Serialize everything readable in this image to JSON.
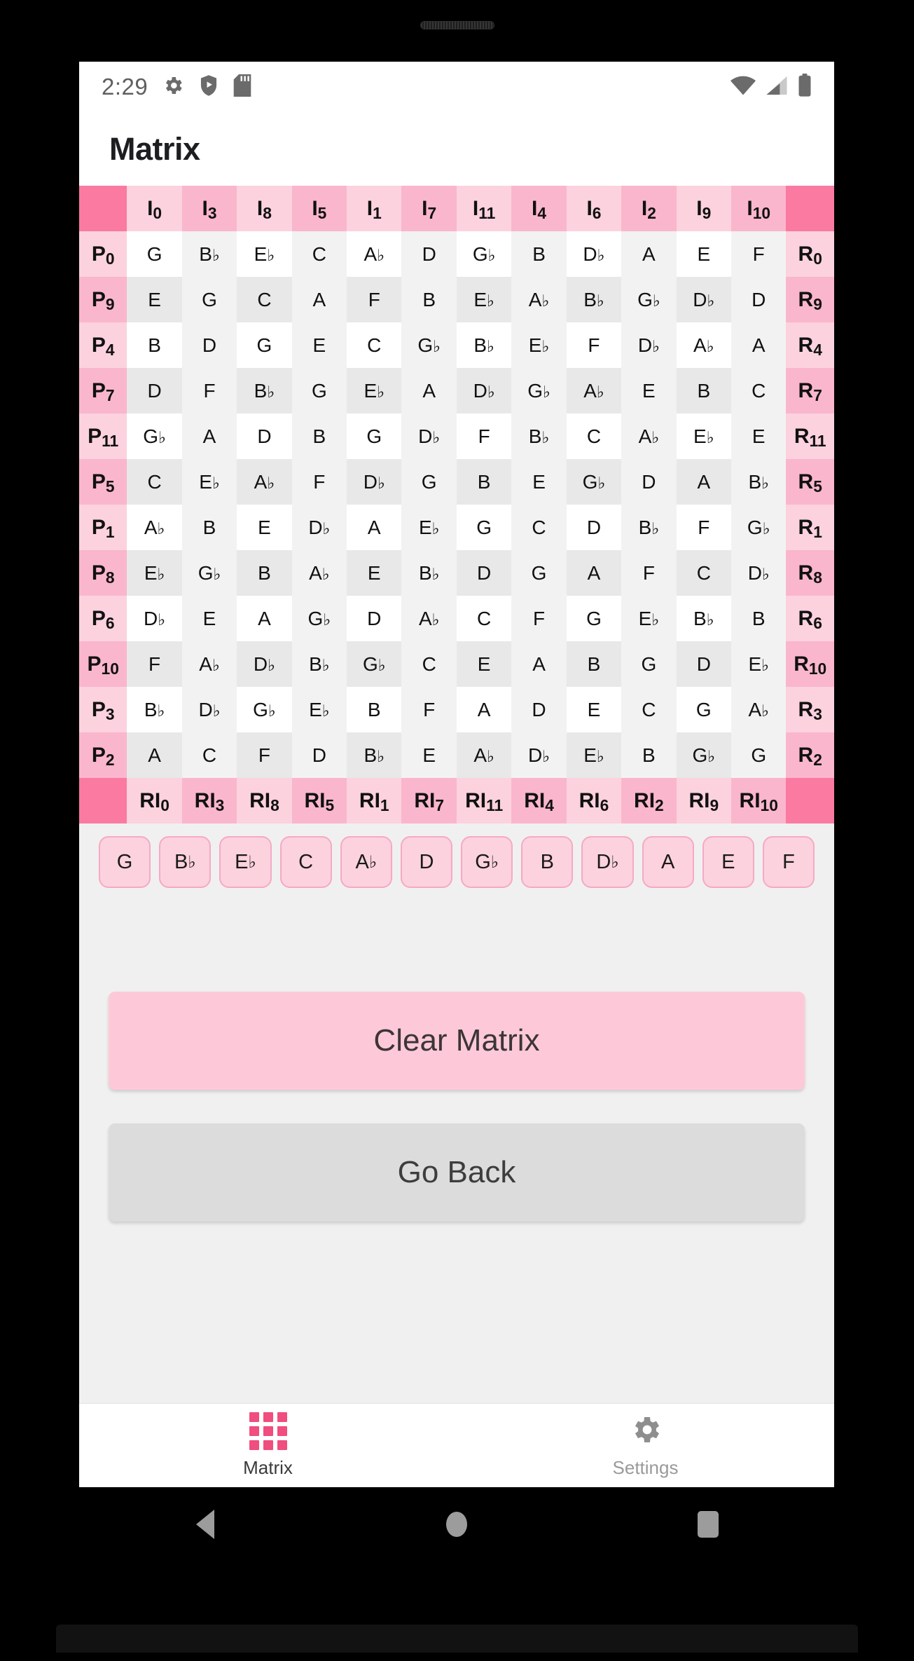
{
  "statusbar": {
    "time": "2:29",
    "icons_left": [
      "gear-icon",
      "shield-play-icon",
      "sd-card-icon"
    ],
    "icons_right": [
      "wifi-icon",
      "cell-signal-icon",
      "battery-icon"
    ]
  },
  "appbar": {
    "title": "Matrix"
  },
  "colors": {
    "accent": "#ef4e7f",
    "corner": "#fa7aa1",
    "header_light": "#fcd2de",
    "header_dark": "#fab6cd",
    "chip_fill": "#fcd2de",
    "chip_border": "#f6a9c4",
    "primary_button": "#fdc9d8",
    "secondary_button": "#dcdcdc"
  },
  "matrix": {
    "corner_top_left": "",
    "corner_top_right": "",
    "corner_bottom_left": "",
    "corner_bottom_right": "",
    "column_headers_top": [
      {
        "p": "I",
        "s": "0"
      },
      {
        "p": "I",
        "s": "3"
      },
      {
        "p": "I",
        "s": "8"
      },
      {
        "p": "I",
        "s": "5"
      },
      {
        "p": "I",
        "s": "1"
      },
      {
        "p": "I",
        "s": "7"
      },
      {
        "p": "I",
        "s": "11"
      },
      {
        "p": "I",
        "s": "4"
      },
      {
        "p": "I",
        "s": "6"
      },
      {
        "p": "I",
        "s": "2"
      },
      {
        "p": "I",
        "s": "9"
      },
      {
        "p": "I",
        "s": "10"
      }
    ],
    "column_headers_bottom": [
      {
        "p": "RI",
        "s": "0"
      },
      {
        "p": "RI",
        "s": "3"
      },
      {
        "p": "RI",
        "s": "8"
      },
      {
        "p": "RI",
        "s": "5"
      },
      {
        "p": "RI",
        "s": "1"
      },
      {
        "p": "RI",
        "s": "7"
      },
      {
        "p": "RI",
        "s": "11"
      },
      {
        "p": "RI",
        "s": "4"
      },
      {
        "p": "RI",
        "s": "6"
      },
      {
        "p": "RI",
        "s": "2"
      },
      {
        "p": "RI",
        "s": "9"
      },
      {
        "p": "RI",
        "s": "10"
      }
    ],
    "row_labels_left": [
      {
        "p": "P",
        "s": "0"
      },
      {
        "p": "P",
        "s": "9"
      },
      {
        "p": "P",
        "s": "4"
      },
      {
        "p": "P",
        "s": "7"
      },
      {
        "p": "P",
        "s": "11"
      },
      {
        "p": "P",
        "s": "5"
      },
      {
        "p": "P",
        "s": "1"
      },
      {
        "p": "P",
        "s": "8"
      },
      {
        "p": "P",
        "s": "6"
      },
      {
        "p": "P",
        "s": "10"
      },
      {
        "p": "P",
        "s": "3"
      },
      {
        "p": "P",
        "s": "2"
      }
    ],
    "row_labels_right": [
      {
        "p": "R",
        "s": "0"
      },
      {
        "p": "R",
        "s": "9"
      },
      {
        "p": "R",
        "s": "4"
      },
      {
        "p": "R",
        "s": "7"
      },
      {
        "p": "R",
        "s": "11"
      },
      {
        "p": "R",
        "s": "5"
      },
      {
        "p": "R",
        "s": "1"
      },
      {
        "p": "R",
        "s": "8"
      },
      {
        "p": "R",
        "s": "6"
      },
      {
        "p": "R",
        "s": "10"
      },
      {
        "p": "R",
        "s": "3"
      },
      {
        "p": "R",
        "s": "2"
      }
    ],
    "rows": [
      [
        "G",
        "B♭",
        "E♭",
        "C",
        "A♭",
        "D",
        "G♭",
        "B",
        "D♭",
        "A",
        "E",
        "F"
      ],
      [
        "E",
        "G",
        "C",
        "A",
        "F",
        "B",
        "E♭",
        "A♭",
        "B♭",
        "G♭",
        "D♭",
        "D"
      ],
      [
        "B",
        "D",
        "G",
        "E",
        "C",
        "G♭",
        "B♭",
        "E♭",
        "F",
        "D♭",
        "A♭",
        "A"
      ],
      [
        "D",
        "F",
        "B♭",
        "G",
        "E♭",
        "A",
        "D♭",
        "G♭",
        "A♭",
        "E",
        "B",
        "C"
      ],
      [
        "G♭",
        "A",
        "D",
        "B",
        "G",
        "D♭",
        "F",
        "B♭",
        "C",
        "A♭",
        "E♭",
        "E"
      ],
      [
        "C",
        "E♭",
        "A♭",
        "F",
        "D♭",
        "G",
        "B",
        "E",
        "G♭",
        "D",
        "A",
        "B♭"
      ],
      [
        "A♭",
        "B",
        "E",
        "D♭",
        "A",
        "E♭",
        "G",
        "C",
        "D",
        "B♭",
        "F",
        "G♭"
      ],
      [
        "E♭",
        "G♭",
        "B",
        "A♭",
        "E",
        "B♭",
        "D",
        "G",
        "A",
        "F",
        "C",
        "D♭"
      ],
      [
        "D♭",
        "E",
        "A",
        "G♭",
        "D",
        "A♭",
        "C",
        "F",
        "G",
        "E♭",
        "B♭",
        "B"
      ],
      [
        "F",
        "A♭",
        "D♭",
        "B♭",
        "G♭",
        "C",
        "E",
        "A",
        "B",
        "G",
        "D",
        "E♭"
      ],
      [
        "B♭",
        "D♭",
        "G♭",
        "E♭",
        "B",
        "F",
        "A",
        "D",
        "E",
        "C",
        "G",
        "A♭"
      ],
      [
        "A",
        "C",
        "F",
        "D",
        "B♭",
        "E",
        "A♭",
        "D♭",
        "E♭",
        "B",
        "G♭",
        "G"
      ]
    ]
  },
  "note_chips": [
    "G",
    "B♭",
    "E♭",
    "C",
    "A♭",
    "D",
    "G♭",
    "B",
    "D♭",
    "A",
    "E",
    "F"
  ],
  "actions": {
    "clear_label": "Clear Matrix",
    "back_label": "Go Back"
  },
  "bottom_nav": {
    "items": [
      {
        "label": "Matrix",
        "icon": "grid-icon",
        "active": true
      },
      {
        "label": "Settings",
        "icon": "gear-icon",
        "active": false
      }
    ]
  },
  "android_nav": {
    "buttons": [
      "back-triangle-icon",
      "home-circle-icon",
      "recents-square-icon"
    ]
  }
}
